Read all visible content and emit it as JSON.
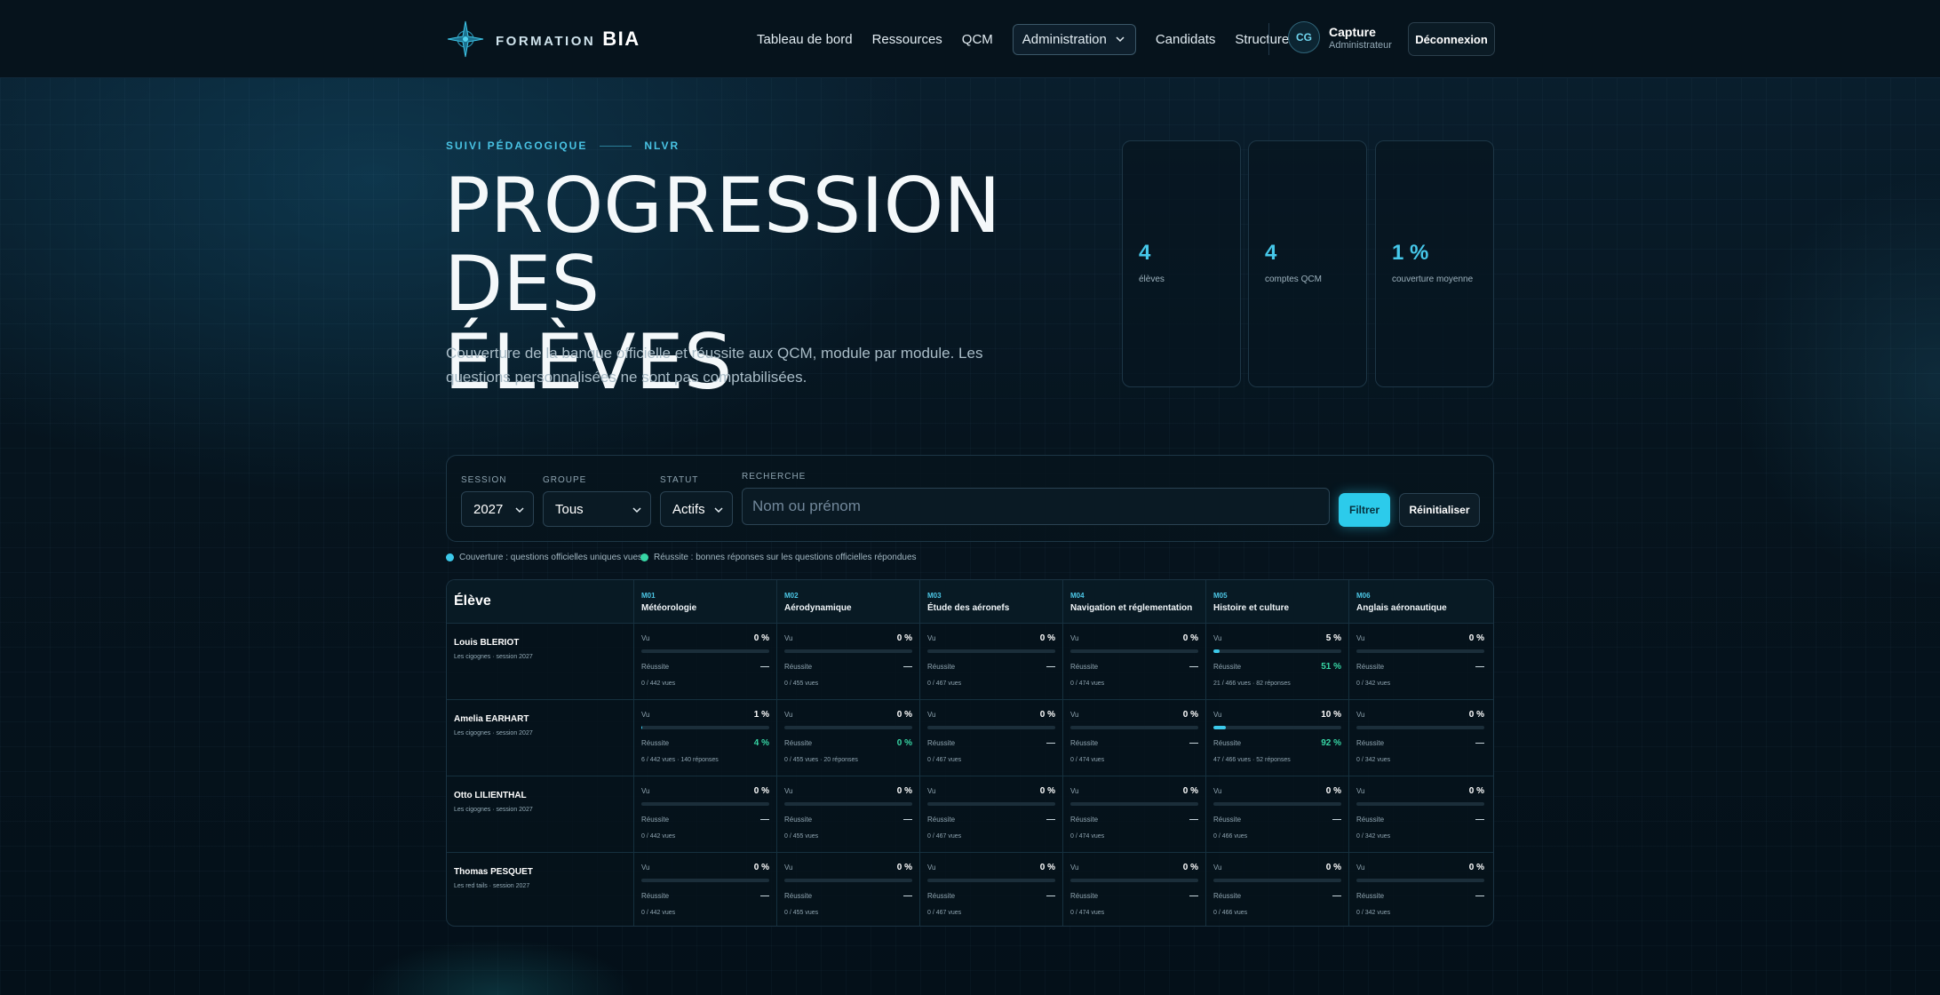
{
  "brand": {
    "prefix": "FORMATION",
    "name": "BIA"
  },
  "nav": {
    "links": [
      "Tableau de bord",
      "Ressources",
      "QCM"
    ],
    "active": "Administration",
    "links_after": [
      "Candidats",
      "Structures"
    ]
  },
  "user": {
    "initials": "CG",
    "name": "Capture",
    "role": "Administrateur"
  },
  "logout_label": "Déconnexion",
  "hero": {
    "eyebrow": "SUIVI PÉDAGOGIQUE",
    "eyebrow_tag": "NLVR",
    "title_line1": "PROGRESSION DES",
    "title_line2": "ÉLÈVES",
    "description": "Couverture de la banque officielle et réussite aux QCM, module par module. Les questions personnalisées ne sont pas comptabilisées."
  },
  "stats": [
    {
      "value": "4",
      "label": "élèves"
    },
    {
      "value": "4",
      "label": "comptes QCM"
    },
    {
      "value": "1 %",
      "label": "couverture moyenne"
    }
  ],
  "filters": {
    "session": {
      "label": "SESSION",
      "value": "2027"
    },
    "groupe": {
      "label": "GROUPE",
      "value": "Tous"
    },
    "statut": {
      "label": "STATUT",
      "value": "Actifs"
    },
    "recherche": {
      "label": "RECHERCHE",
      "placeholder": "Nom ou prénom"
    },
    "filter_label": "Filtrer",
    "reset_label": "Réinitialiser"
  },
  "legend": {
    "coverage": "Couverture : questions officielles uniques vues",
    "success": "Réussite : bonnes réponses sur les questions officielles répondues"
  },
  "colors": {
    "accent": "#3cc9ea",
    "success": "#37d6a5"
  },
  "table": {
    "header_student": "Élève",
    "label_vu": "Vu",
    "label_reussite": "Réussite",
    "modules": [
      {
        "code": "M01",
        "name": "Météorologie"
      },
      {
        "code": "M02",
        "name": "Aérodynamique"
      },
      {
        "code": "M03",
        "name": "Étude des aéronefs"
      },
      {
        "code": "M04",
        "name": "Navigation et réglementation"
      },
      {
        "code": "M05",
        "name": "Histoire et culture"
      },
      {
        "code": "M06",
        "name": "Anglais aéronautique"
      }
    ],
    "rows": [
      {
        "name": "Louis BLERIOT",
        "group": "Les cigognes · session 2027",
        "cells": [
          {
            "vu": "0 %",
            "coverage": 0,
            "reussite": "—",
            "footer": "0 / 442 vues"
          },
          {
            "vu": "0 %",
            "coverage": 0,
            "reussite": "—",
            "footer": "0 / 455 vues"
          },
          {
            "vu": "0 %",
            "coverage": 0,
            "reussite": "—",
            "footer": "0 / 467 vues"
          },
          {
            "vu": "0 %",
            "coverage": 0,
            "reussite": "—",
            "footer": "0 / 474 vues"
          },
          {
            "vu": "5 %",
            "coverage": 5,
            "reussite": "51 %",
            "footer": "21 / 466 vues · 82 réponses"
          },
          {
            "vu": "0 %",
            "coverage": 0,
            "reussite": "—",
            "footer": "0 / 342 vues"
          }
        ]
      },
      {
        "name": "Amelia EARHART",
        "group": "Les cigognes · session 2027",
        "cells": [
          {
            "vu": "1 %",
            "coverage": 1,
            "reussite": "4 %",
            "footer": "6 / 442 vues · 140 réponses"
          },
          {
            "vu": "0 %",
            "coverage": 0,
            "reussite": "0 %",
            "footer": "0 / 455 vues · 20 réponses"
          },
          {
            "vu": "0 %",
            "coverage": 0,
            "reussite": "—",
            "footer": "0 / 467 vues"
          },
          {
            "vu": "0 %",
            "coverage": 0,
            "reussite": "—",
            "footer": "0 / 474 vues"
          },
          {
            "vu": "10 %",
            "coverage": 10,
            "reussite": "92 %",
            "footer": "47 / 466 vues · 52 réponses"
          },
          {
            "vu": "0 %",
            "coverage": 0,
            "reussite": "—",
            "footer": "0 / 342 vues"
          }
        ]
      },
      {
        "name": "Otto LILIENTHAL",
        "group": "Les cigognes · session 2027",
        "cells": [
          {
            "vu": "0 %",
            "coverage": 0,
            "reussite": "—",
            "footer": "0 / 442 vues"
          },
          {
            "vu": "0 %",
            "coverage": 0,
            "reussite": "—",
            "footer": "0 / 455 vues"
          },
          {
            "vu": "0 %",
            "coverage": 0,
            "reussite": "—",
            "footer": "0 / 467 vues"
          },
          {
            "vu": "0 %",
            "coverage": 0,
            "reussite": "—",
            "footer": "0 / 474 vues"
          },
          {
            "vu": "0 %",
            "coverage": 0,
            "reussite": "—",
            "footer": "0 / 466 vues"
          },
          {
            "vu": "0 %",
            "coverage": 0,
            "reussite": "—",
            "footer": "0 / 342 vues"
          }
        ]
      },
      {
        "name": "Thomas PESQUET",
        "group": "Les red tails · session 2027",
        "cells": [
          {
            "vu": "0 %",
            "coverage": 0,
            "reussite": "—",
            "footer": "0 / 442 vues"
          },
          {
            "vu": "0 %",
            "coverage": 0,
            "reussite": "—",
            "footer": "0 / 455 vues"
          },
          {
            "vu": "0 %",
            "coverage": 0,
            "reussite": "—",
            "footer": "0 / 467 vues"
          },
          {
            "vu": "0 %",
            "coverage": 0,
            "reussite": "—",
            "footer": "0 / 474 vues"
          },
          {
            "vu": "0 %",
            "coverage": 0,
            "reussite": "—",
            "footer": "0 / 466 vues"
          },
          {
            "vu": "0 %",
            "coverage": 0,
            "reussite": "—",
            "footer": "0 / 342 vues"
          }
        ]
      }
    ]
  }
}
